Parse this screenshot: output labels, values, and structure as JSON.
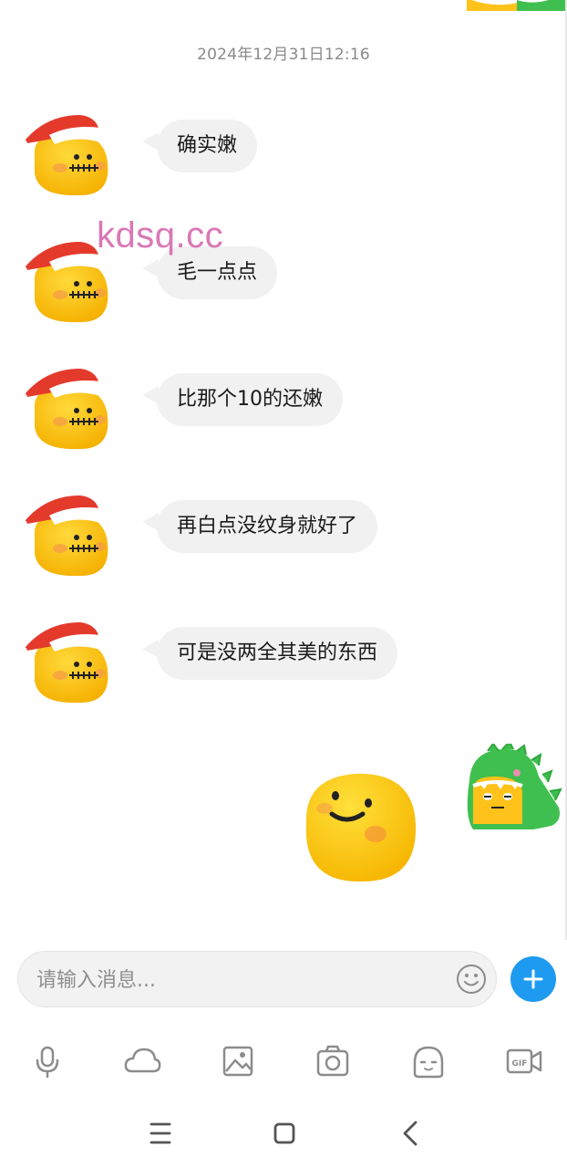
{
  "chat": {
    "timestamp": "2024年12月31日12:16",
    "messages": [
      {
        "sender": "other",
        "text": "确实嫩"
      },
      {
        "sender": "other",
        "text": "毛一点点"
      },
      {
        "sender": "other",
        "text": "比那个10的还嫩"
      },
      {
        "sender": "other",
        "text": "再白点没纹身就好了"
      },
      {
        "sender": "other",
        "text": "可是没两全其美的东西"
      }
    ],
    "sent_sticker": "smiling-yellow-blob-sticker",
    "watermark": "kdsq.cc"
  },
  "input": {
    "placeholder": "请输入消息..."
  },
  "toolbar": {
    "items": [
      "microphone-icon",
      "cloud-icon",
      "image-icon",
      "camera-icon",
      "sticker-icon",
      "gif-icon"
    ]
  },
  "colors": {
    "bubble": "#f1f1f1",
    "accent": "#1e9bf0",
    "watermark": "#d978b6",
    "blob_yellow": "#ffc21a",
    "hat_red": "#e43a2c",
    "dino_green": "#3fbf4f"
  }
}
